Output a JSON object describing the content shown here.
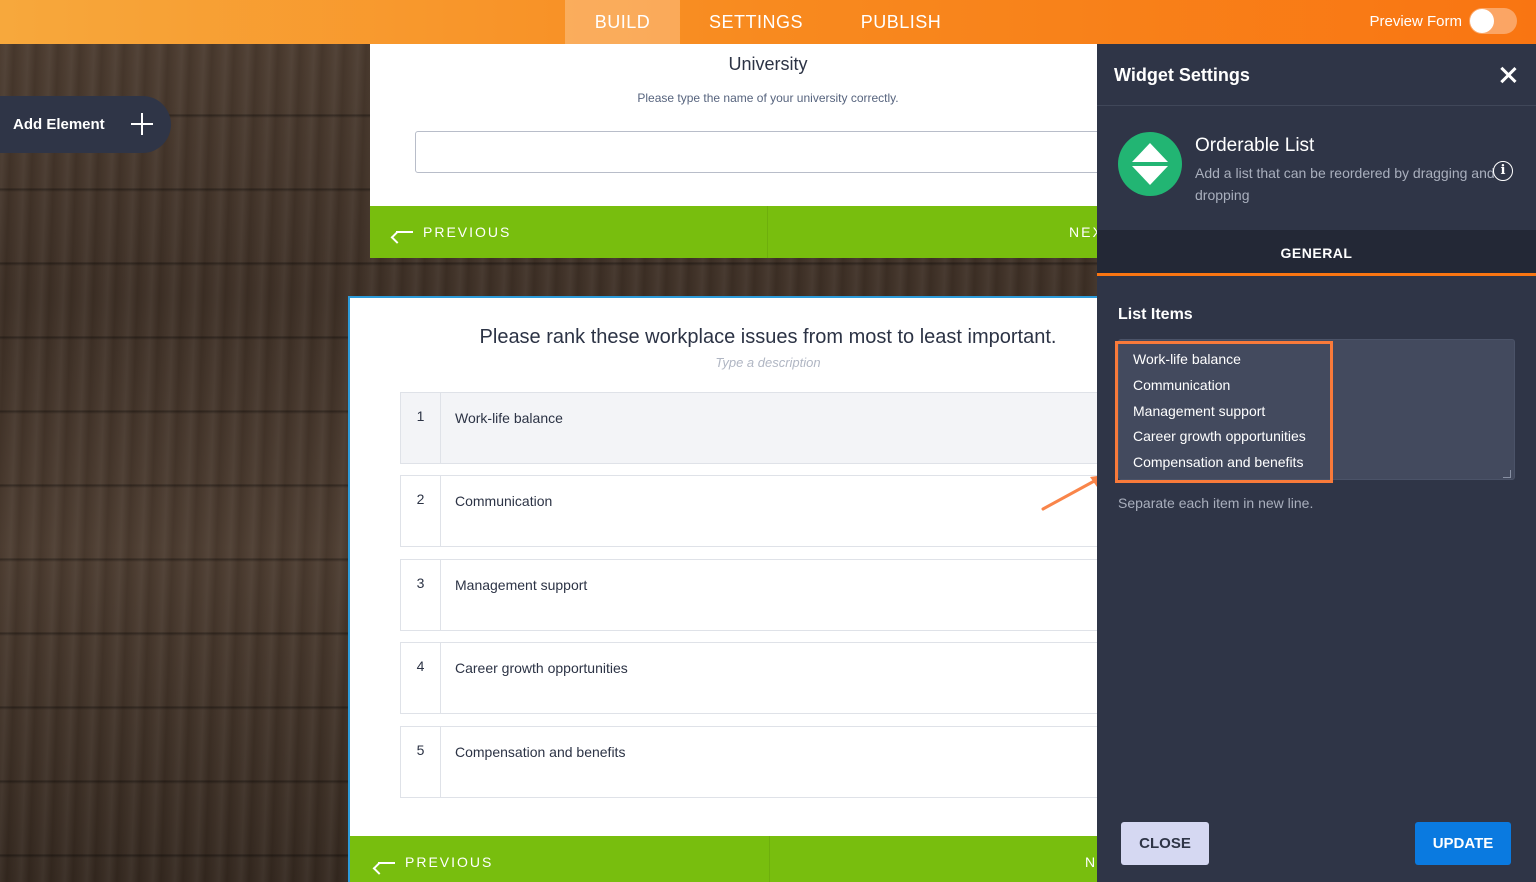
{
  "topbar": {
    "tabs": [
      {
        "label": "BUILD"
      },
      {
        "label": "SETTINGS"
      },
      {
        "label": "PUBLISH"
      }
    ],
    "preview_label": "Preview Form"
  },
  "sidebar": {
    "add_element_label": "Add Element"
  },
  "card1": {
    "title": "University",
    "subtitle": "Please type the name of your university correctly.",
    "prev_label": "PREVIOUS",
    "next_label": "NEX"
  },
  "card2": {
    "title": "Please rank these workplace issues from most to least important.",
    "description": "Type a description",
    "items": [
      {
        "num": "1",
        "text": "Work-life balance"
      },
      {
        "num": "2",
        "text": "Communication"
      },
      {
        "num": "3",
        "text": "Management support"
      },
      {
        "num": "4",
        "text": "Career growth opportunities"
      },
      {
        "num": "5",
        "text": "Compensation and benefits"
      }
    ],
    "prev_label": "PREVIOUS",
    "next_label": "N"
  },
  "panel": {
    "title": "Widget Settings",
    "widget_name": "Orderable List",
    "widget_desc": "Add a list that can be reordered by dragging and dropping",
    "info_glyph": "i",
    "tab_label": "GENERAL",
    "list_items_label": "List Items",
    "list_lines": [
      "Work-life balance",
      "Communication",
      "Management support",
      "Career growth opportunities",
      "Compensation and benefits"
    ],
    "helper_text": "Separate each item in new line.",
    "close_label": "CLOSE",
    "update_label": "UPDATE"
  },
  "colors": {
    "accent_orange": "#f97512",
    "nav_green": "#78be0e",
    "panel_bg": "#2f3547",
    "update_blue": "#0a7ae0",
    "widget_green": "#22b573"
  }
}
